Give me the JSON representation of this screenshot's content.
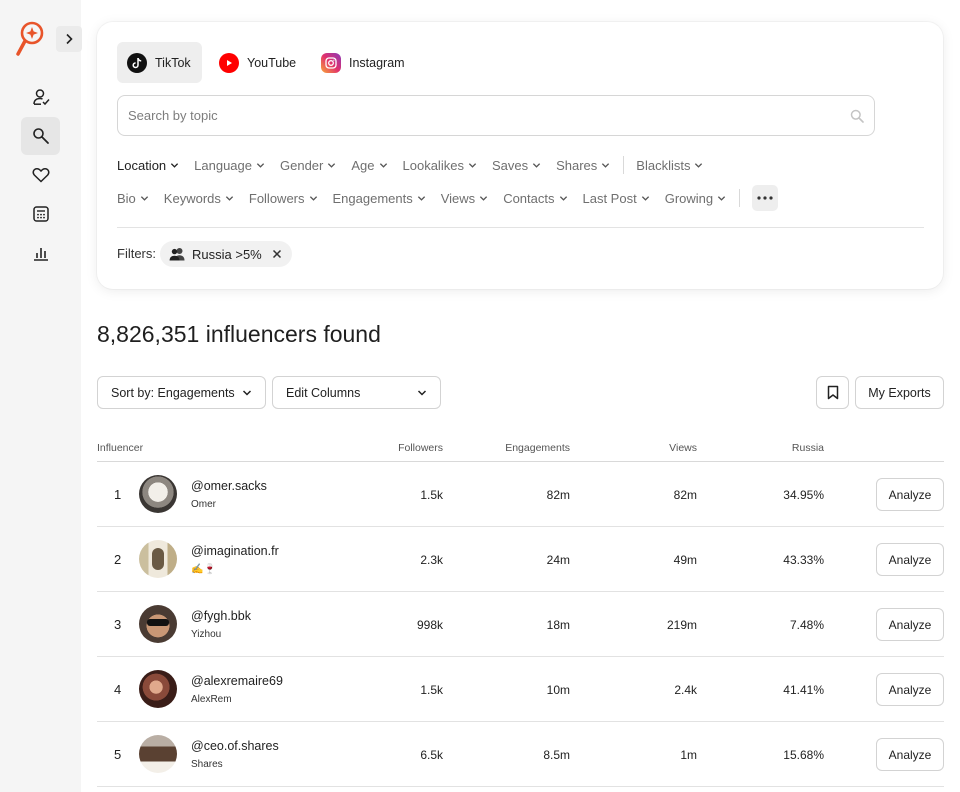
{
  "colors": {
    "brand": "#e8542a",
    "youtube": "#ff0000",
    "tiktok": "#111111"
  },
  "sidebar": {
    "items": [
      {
        "icon": "user-check-icon",
        "active": false
      },
      {
        "icon": "search-icon",
        "active": true
      },
      {
        "icon": "heart-icon",
        "active": false
      },
      {
        "icon": "calculator-icon",
        "active": false
      },
      {
        "icon": "bar-chart-icon",
        "active": false
      }
    ]
  },
  "platforms": [
    {
      "label": "TikTok",
      "icon": "tiktok-icon",
      "active": true
    },
    {
      "label": "YouTube",
      "icon": "youtube-icon",
      "active": false
    },
    {
      "label": "Instagram",
      "icon": "instagram-icon",
      "active": false
    }
  ],
  "search": {
    "placeholder": "Search by topic"
  },
  "filters_row1": [
    "Location",
    "Language",
    "Gender",
    "Age",
    "Lookalikes",
    "Saves",
    "Shares",
    "Blacklists"
  ],
  "filters_row2": [
    "Bio",
    "Keywords",
    "Followers",
    "Engagements",
    "Views",
    "Contacts",
    "Last Post",
    "Growing"
  ],
  "active_filters": {
    "label": "Filters:",
    "chips": [
      "Russia >5%"
    ]
  },
  "results": {
    "title": "8,826,351 influencers found"
  },
  "controls": {
    "sort_label": "Sort by: Engagements",
    "columns_label": "Edit Columns",
    "exports_label": "My Exports"
  },
  "table": {
    "headers": {
      "influencer": "Influencer",
      "followers": "Followers",
      "engagements": "Engagements",
      "views": "Views",
      "country": "Russia"
    },
    "action_label": "Analyze",
    "rows": [
      {
        "rank": "1",
        "handle": "@omer.sacks",
        "name": "Omer",
        "followers": "1.5k",
        "engagements": "82m",
        "views": "82m",
        "country_pct": "34.95%"
      },
      {
        "rank": "2",
        "handle": "@imagination.fr",
        "name": "✍️🍷",
        "followers": "2.3k",
        "engagements": "24m",
        "views": "49m",
        "country_pct": "43.33%"
      },
      {
        "rank": "3",
        "handle": "@fygh.bbk",
        "name": "Yizhou",
        "followers": "998k",
        "engagements": "18m",
        "views": "219m",
        "country_pct": "7.48%"
      },
      {
        "rank": "4",
        "handle": "@alexremaire69",
        "name": "AlexRem",
        "followers": "1.5k",
        "engagements": "10m",
        "views": "2.4k",
        "country_pct": "41.41%"
      },
      {
        "rank": "5",
        "handle": "@ceo.of.shares",
        "name": "Shares",
        "followers": "6.5k",
        "engagements": "8.5m",
        "views": "1m",
        "country_pct": "15.68%"
      }
    ]
  }
}
